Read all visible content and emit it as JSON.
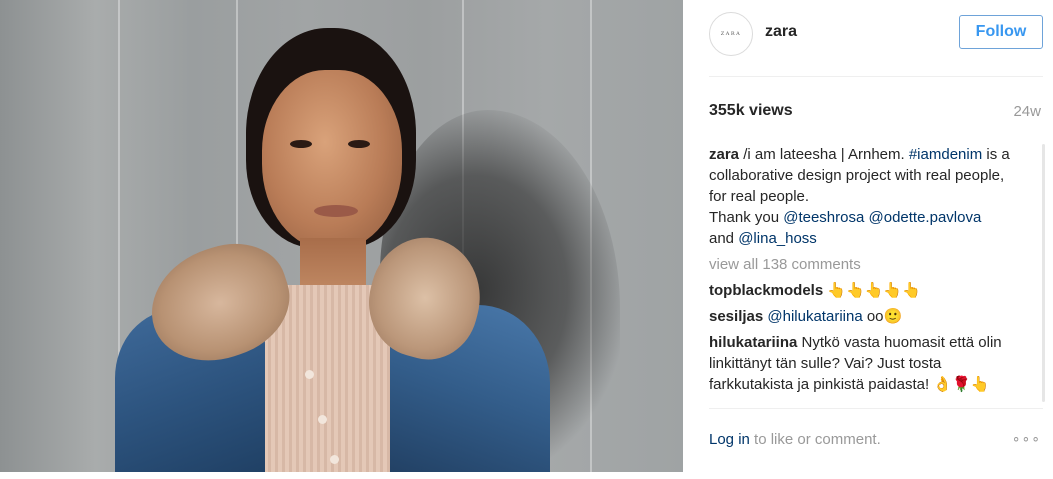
{
  "post": {
    "account": {
      "name": "zara",
      "avatar_text": "ZARA"
    },
    "follow_label": "Follow",
    "views": "355k views",
    "age": "24w",
    "caption": {
      "user": "zara",
      "text_1": " /i am lateesha | Arnhem. ",
      "hashtag": "#iamdenim",
      "text_2": " is a collaborative design project with real people, for real people.",
      "text_3": "Thank you ",
      "mention_1": "@teeshrosa",
      "mention_2": "@odette.pavlova",
      "text_4": "and ",
      "mention_3": "@lina_hoss"
    },
    "view_all_comments": "view all 138 comments",
    "comments": [
      {
        "user": "topblackmodels",
        "text": " 👆👆👆👆👆"
      },
      {
        "user": "sesiljas",
        "mention": "@hilukatariina",
        "text": " oo🙂"
      },
      {
        "user": "hilukatariina",
        "text": " Nytkö vasta huomasit että olin linkittänyt tän sulle? Vai? Just tosta farkkutakista ja pinkistä paidasta! 👌🌹👆"
      }
    ],
    "footer": {
      "login": "Log in",
      "rest": " to like or comment.",
      "more": "∘∘∘"
    }
  },
  "colors": {
    "accent": "#3897f0",
    "link": "#003569",
    "muted": "#999999"
  },
  "icons": {
    "more": "more-options-icon"
  }
}
